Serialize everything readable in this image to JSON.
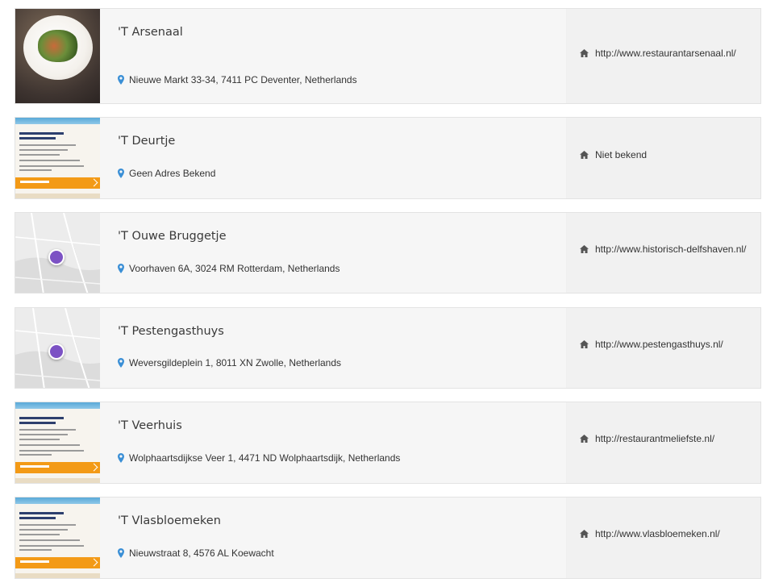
{
  "restaurants": [
    {
      "name": "'T Arsenaal",
      "address": "Nieuwe Markt 33-34, 7411 PC Deventer, Netherlands",
      "website": "http://www.restaurantarsenaal.nl/",
      "thumbnail": "food-photo"
    },
    {
      "name": "'T Deurtje",
      "address": "Geen Adres Bekend",
      "website": "Niet bekend",
      "thumbnail": "advertisement-banner"
    },
    {
      "name": "'T Ouwe Bruggetje",
      "address": "Voorhaven 6A, 3024 RM Rotterdam, Netherlands",
      "website": "http://www.historisch-delfshaven.nl/",
      "thumbnail": "map"
    },
    {
      "name": "'T Pestengasthuys",
      "address": "Weversgildeplein 1, 8011 XN Zwolle, Netherlands",
      "website": "http://www.pestengasthuys.nl/",
      "thumbnail": "map"
    },
    {
      "name": "'T Veerhuis",
      "address": "Wolphaartsdijkse Veer 1, 4471 ND Wolphaartsdijk, Netherlands",
      "website": "http://restaurantmeliefste.nl/",
      "thumbnail": "advertisement-banner"
    },
    {
      "name": "'T Vlasbloemeken",
      "address": "Nieuwstraat 8, 4576 AL Koewacht",
      "website": "http://www.vlasbloemeken.nl/",
      "thumbnail": "advertisement-banner"
    }
  ],
  "icons": {
    "address": "map-pin-icon",
    "website": "home-icon"
  },
  "colors": {
    "pin": "#3a8fd6",
    "map_marker": "#7c52c4",
    "card_bg": "#f6f6f6",
    "ad_button": "#f39a16"
  }
}
